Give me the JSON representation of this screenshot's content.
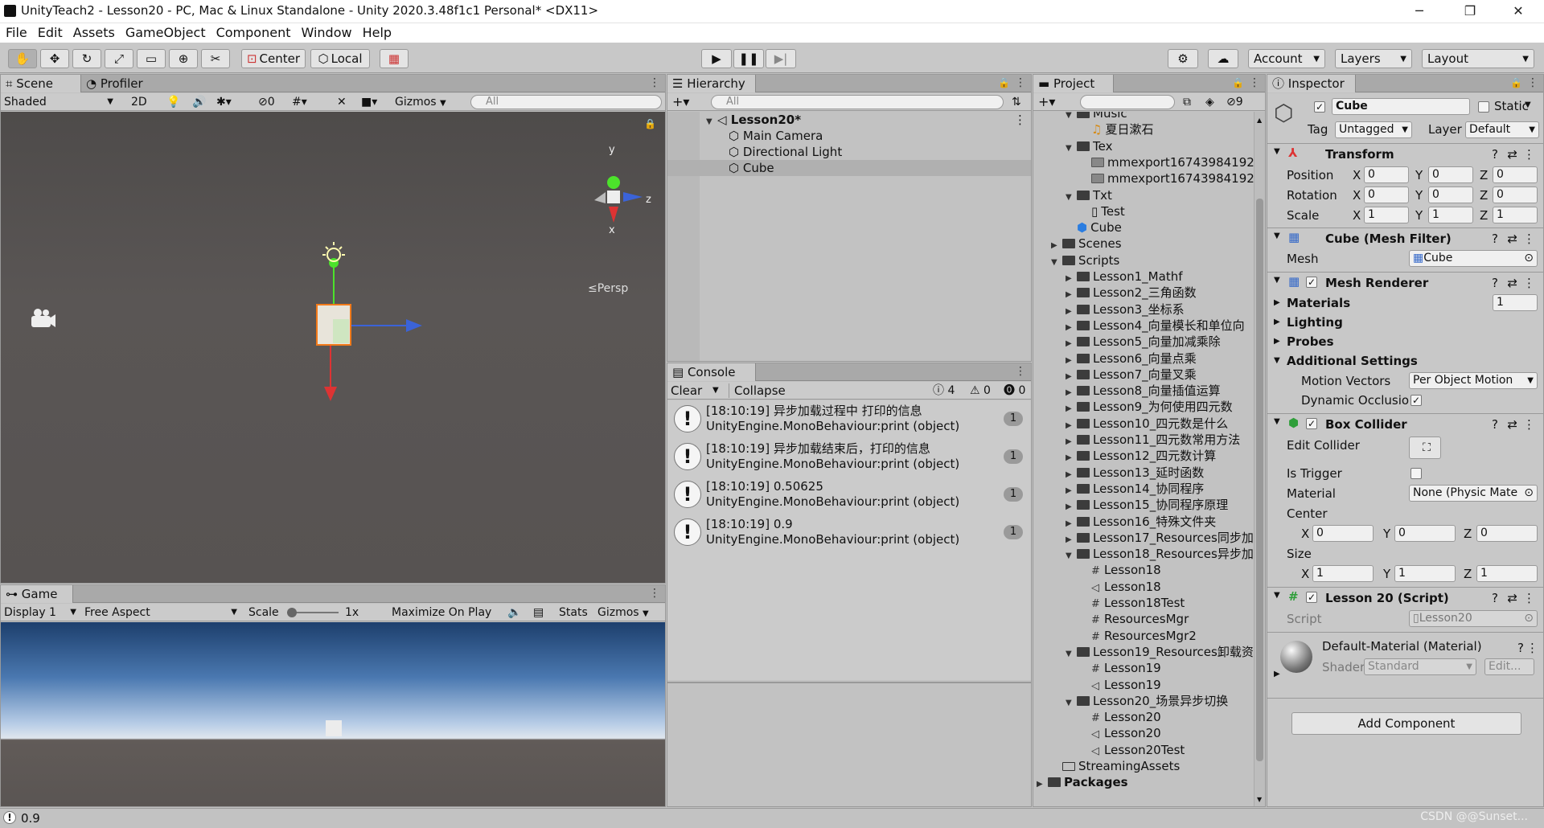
{
  "window": {
    "title": "UnityTeach2 - Lesson20 - PC, Mac & Linux Standalone - Unity 2020.3.48f1c1 Personal* <DX11>",
    "minimize": "─",
    "restore": "❐",
    "close": "✕"
  },
  "menu": [
    "File",
    "Edit",
    "Assets",
    "GameObject",
    "Component",
    "Window",
    "Help"
  ],
  "toolbar": {
    "center": "Center",
    "local": "Local",
    "account": "Account",
    "layers": "Layers",
    "layout": "Layout"
  },
  "scene": {
    "tabs": [
      "Scene",
      "Profiler"
    ],
    "shading": "Shaded",
    "mode2d": "2D",
    "hidden_count": "0",
    "gizmos": "Gizmos",
    "search_placeholder": "All",
    "persp": "Persp",
    "axis_y": "y",
    "axis_z": "z",
    "axis_x": "x"
  },
  "game": {
    "tab": "Game",
    "display": "Display 1",
    "aspect": "Free Aspect",
    "scale_label": "Scale",
    "scale_value": "1x",
    "maximize": "Maximize On Play",
    "stats": "Stats",
    "gizmos": "Gizmos"
  },
  "hierarchy": {
    "tab": "Hierarchy",
    "search_placeholder": "All",
    "scene": "Lesson20*",
    "items": [
      "Main Camera",
      "Directional Light",
      "Cube"
    ]
  },
  "console": {
    "tab": "Console",
    "clear": "Clear",
    "collapse": "Collapse",
    "log_count": "4",
    "warn_count": "0",
    "error_count": "0",
    "entries": [
      {
        "line1": "[18:10:19] 异步加载过程中 打印的信息",
        "line2": "UnityEngine.MonoBehaviour:print (object)",
        "count": "1"
      },
      {
        "line1": "[18:10:19] 异步加载结束后，打印的信息",
        "line2": "UnityEngine.MonoBehaviour:print (object)",
        "count": "1"
      },
      {
        "line1": "[18:10:19] 0.50625",
        "line2": "UnityEngine.MonoBehaviour:print (object)",
        "count": "1"
      },
      {
        "line1": "[18:10:19] 0.9",
        "line2": "UnityEngine.MonoBehaviour:print (object)",
        "count": "1"
      }
    ]
  },
  "project": {
    "tab": "Project",
    "hidden_count": "9",
    "items": [
      {
        "label": "Music",
        "depth": 2,
        "kind": "folder",
        "fold": "▼"
      },
      {
        "label": "夏日漱石",
        "depth": 3,
        "kind": "audio",
        "fold": ""
      },
      {
        "label": "Tex",
        "depth": 2,
        "kind": "folder",
        "fold": "▼"
      },
      {
        "label": "mmexport16743984192",
        "depth": 3,
        "kind": "image",
        "fold": ""
      },
      {
        "label": "mmexport16743984192",
        "depth": 3,
        "kind": "image",
        "fold": ""
      },
      {
        "label": "Txt",
        "depth": 2,
        "kind": "folder",
        "fold": "▼"
      },
      {
        "label": "Test",
        "depth": 3,
        "kind": "text",
        "fold": ""
      },
      {
        "label": "Cube",
        "depth": 2,
        "kind": "prefab",
        "fold": ""
      },
      {
        "label": "Scenes",
        "depth": 1,
        "kind": "folder",
        "fold": "▶"
      },
      {
        "label": "Scripts",
        "depth": 1,
        "kind": "folder",
        "fold": "▼"
      },
      {
        "label": "Lesson1_Mathf",
        "depth": 2,
        "kind": "folder",
        "fold": "▶"
      },
      {
        "label": "Lesson2_三角函数",
        "depth": 2,
        "kind": "folder",
        "fold": "▶"
      },
      {
        "label": "Lesson3_坐标系",
        "depth": 2,
        "kind": "folder",
        "fold": "▶"
      },
      {
        "label": "Lesson4_向量模长和单位向",
        "depth": 2,
        "kind": "folder",
        "fold": "▶"
      },
      {
        "label": "Lesson5_向量加减乘除",
        "depth": 2,
        "kind": "folder",
        "fold": "▶"
      },
      {
        "label": "Lesson6_向量点乘",
        "depth": 2,
        "kind": "folder",
        "fold": "▶"
      },
      {
        "label": "Lesson7_向量叉乘",
        "depth": 2,
        "kind": "folder",
        "fold": "▶"
      },
      {
        "label": "Lesson8_向量插值运算",
        "depth": 2,
        "kind": "folder",
        "fold": "▶"
      },
      {
        "label": "Lesson9_为何使用四元数",
        "depth": 2,
        "kind": "folder",
        "fold": "▶"
      },
      {
        "label": "Lesson10_四元数是什么",
        "depth": 2,
        "kind": "folder",
        "fold": "▶"
      },
      {
        "label": "Lesson11_四元数常用方法",
        "depth": 2,
        "kind": "folder",
        "fold": "▶"
      },
      {
        "label": "Lesson12_四元数计算",
        "depth": 2,
        "kind": "folder",
        "fold": "▶"
      },
      {
        "label": "Lesson13_延时函数",
        "depth": 2,
        "kind": "folder",
        "fold": "▶"
      },
      {
        "label": "Lesson14_协同程序",
        "depth": 2,
        "kind": "folder",
        "fold": "▶"
      },
      {
        "label": "Lesson15_协同程序原理",
        "depth": 2,
        "kind": "folder",
        "fold": "▶"
      },
      {
        "label": "Lesson16_特殊文件夹",
        "depth": 2,
        "kind": "folder",
        "fold": "▶"
      },
      {
        "label": "Lesson17_Resources同步加",
        "depth": 2,
        "kind": "folder",
        "fold": "▶"
      },
      {
        "label": "Lesson18_Resources异步加",
        "depth": 2,
        "kind": "folder",
        "fold": "▼"
      },
      {
        "label": "Lesson18",
        "depth": 3,
        "kind": "script",
        "fold": ""
      },
      {
        "label": "Lesson18",
        "depth": 3,
        "kind": "scene",
        "fold": ""
      },
      {
        "label": "Lesson18Test",
        "depth": 3,
        "kind": "script",
        "fold": ""
      },
      {
        "label": "ResourcesMgr",
        "depth": 3,
        "kind": "script",
        "fold": ""
      },
      {
        "label": "ResourcesMgr2",
        "depth": 3,
        "kind": "script",
        "fold": ""
      },
      {
        "label": "Lesson19_Resources卸载资",
        "depth": 2,
        "kind": "folder",
        "fold": "▼"
      },
      {
        "label": "Lesson19",
        "depth": 3,
        "kind": "script",
        "fold": ""
      },
      {
        "label": "Lesson19",
        "depth": 3,
        "kind": "scene",
        "fold": ""
      },
      {
        "label": "Lesson20_场景异步切换",
        "depth": 2,
        "kind": "folder",
        "fold": "▼"
      },
      {
        "label": "Lesson20",
        "depth": 3,
        "kind": "script",
        "fold": ""
      },
      {
        "label": "Lesson20",
        "depth": 3,
        "kind": "scene",
        "fold": ""
      },
      {
        "label": "Lesson20Test",
        "depth": 3,
        "kind": "scene",
        "fold": ""
      },
      {
        "label": "StreamingAssets",
        "depth": 1,
        "kind": "emptyfolder",
        "fold": ""
      },
      {
        "label": "Packages",
        "depth": 0,
        "kind": "folder",
        "fold": "▶"
      }
    ]
  },
  "inspector": {
    "tab": "Inspector",
    "object_name": "Cube",
    "static": "Static",
    "tag_label": "Tag",
    "tag": "Untagged",
    "layer_label": "Layer",
    "layer": "Default",
    "transform": {
      "title": "Transform",
      "position": "Position",
      "rotation": "Rotation",
      "scale": "Scale",
      "pos": [
        "0",
        "0",
        "0"
      ],
      "rot": [
        "0",
        "0",
        "0"
      ],
      "scl": [
        "1",
        "1",
        "1"
      ]
    },
    "mesh_filter": {
      "title": "Cube (Mesh Filter)",
      "mesh_label": "Mesh",
      "mesh": "Cube"
    },
    "mesh_renderer": {
      "title": "Mesh Renderer",
      "materials": "Materials",
      "materials_count": "1",
      "lighting": "Lighting",
      "probes": "Probes",
      "additional": "Additional Settings",
      "motion_label": "Motion Vectors",
      "motion": "Per Object Motion",
      "dyn_occ": "Dynamic Occlusio"
    },
    "box_collider": {
      "title": "Box Collider",
      "edit": "Edit Collider",
      "trigger": "Is Trigger",
      "material_label": "Material",
      "material": "None (Physic Mate",
      "center": "Center",
      "size": "Size",
      "c": [
        "0",
        "0",
        "0"
      ],
      "s": [
        "1",
        "1",
        "1"
      ]
    },
    "script": {
      "title": "Lesson 20 (Script)",
      "script_label": "Script",
      "script": "Lesson20"
    },
    "material": {
      "title": "Default-Material (Material)",
      "shader_label": "Shader",
      "shader": "Standard",
      "edit": "Edit..."
    },
    "add_component": "Add Component"
  },
  "status": {
    "text": "0.9",
    "watermark": "CSDN @@Sunset..."
  },
  "axes": {
    "x": "X",
    "y": "Y",
    "z": "Z"
  }
}
